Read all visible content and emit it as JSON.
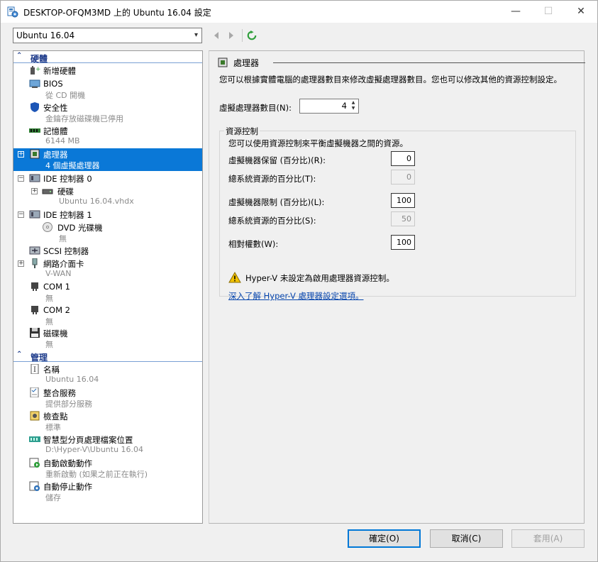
{
  "window": {
    "title": "DESKTOP-OFQM3MD 上的 Ubuntu 16.04 設定",
    "minimize_glyph": "—",
    "maximize_glyph": "☐",
    "close_glyph": "✕"
  },
  "toolbar": {
    "vm_selected": "Ubuntu 16.04"
  },
  "tree": {
    "hardware_header": "硬體",
    "management_header": "管理",
    "hardware_items": [
      {
        "label": "新增硬體",
        "sub": "",
        "icon": "add-hardware-icon"
      },
      {
        "label": "BIOS",
        "sub": "從 CD 開機",
        "icon": "bios-icon"
      },
      {
        "label": "安全性",
        "sub": "金鑰存放磁碟機已停用",
        "icon": "shield-icon"
      },
      {
        "label": "記憶體",
        "sub": "6144 MB",
        "icon": "memory-icon"
      },
      {
        "label": "處理器",
        "sub": "4 個虛擬處理器",
        "icon": "processor-icon"
      },
      {
        "label": "IDE 控制器 0",
        "sub": "",
        "icon": "ide-controller-icon"
      },
      {
        "label": "硬碟",
        "sub": "Ubuntu 16.04.vhdx",
        "icon": "hard-disk-icon"
      },
      {
        "label": "IDE 控制器 1",
        "sub": "",
        "icon": "ide-controller-icon"
      },
      {
        "label": "DVD 光碟機",
        "sub": "無",
        "icon": "dvd-icon"
      },
      {
        "label": "SCSI 控制器",
        "sub": "",
        "icon": "scsi-controller-icon"
      },
      {
        "label": "網路介面卡",
        "sub": "V-WAN",
        "icon": "network-adapter-icon"
      },
      {
        "label": "COM 1",
        "sub": "無",
        "icon": "com-port-icon"
      },
      {
        "label": "COM 2",
        "sub": "無",
        "icon": "com-port-icon"
      },
      {
        "label": "磁碟機",
        "sub": "無",
        "icon": "floppy-icon"
      }
    ],
    "management_items": [
      {
        "label": "名稱",
        "sub": "Ubuntu 16.04",
        "icon": "name-icon"
      },
      {
        "label": "整合服務",
        "sub": "提供部分服務",
        "icon": "integration-services-icon"
      },
      {
        "label": "檢查點",
        "sub": "標準",
        "icon": "checkpoint-icon"
      },
      {
        "label": "智慧型分頁處理檔案位置",
        "sub": "D:\\Hyper-V\\Ubuntu 16.04",
        "icon": "smart-paging-icon"
      },
      {
        "label": "自動啟動動作",
        "sub": "重新啟動 (如果之前正在執行)",
        "icon": "auto-start-icon"
      },
      {
        "label": "自動停止動作",
        "sub": "儲存",
        "icon": "auto-stop-icon"
      }
    ]
  },
  "detail": {
    "title": "處理器",
    "description": "您可以根據實體電腦的處理器數目來修改虛擬處理器數目。您也可以修改其他的資源控制設定。",
    "vcpu_label": "虛擬處理器數目(N):",
    "vcpu_value": "4",
    "resource_group_label": "資源控制",
    "resource_desc": "您可以使用資源控制來平衡虛擬機器之間的資源。",
    "reserve_label": "虛擬機器保留 (百分比)(R):",
    "reserve_value": "0",
    "reserve_total_label": "總系統資源的百分比(T):",
    "reserve_total_value": "0",
    "limit_label": "虛擬機器限制 (百分比)(L):",
    "limit_value": "100",
    "limit_total_label": "總系統資源的百分比(S):",
    "limit_total_value": "50",
    "weight_label": "相對權數(W):",
    "weight_value": "100",
    "warning_text": "Hyper-V 未設定為啟用處理器資源控制。",
    "link_text": "深入了解 Hyper-V 處理器設定選項。"
  },
  "buttons": {
    "ok": "確定(O)",
    "cancel": "取消(C)",
    "apply": "套用(A)"
  },
  "colors": {
    "selection": "#0a78d7",
    "section_header": "#1c3a8a",
    "link": "#0645ad"
  }
}
